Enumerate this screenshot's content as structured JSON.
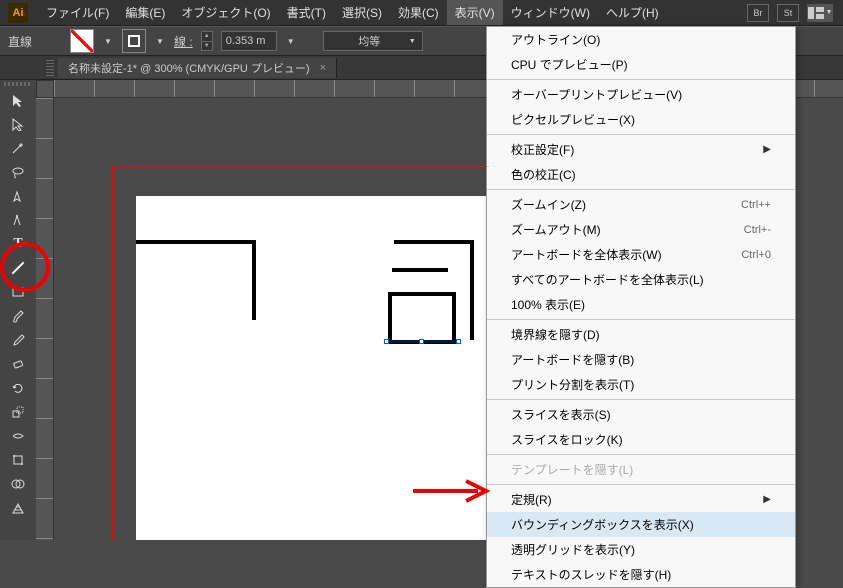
{
  "app": {
    "logo": "Ai"
  },
  "menu": {
    "items": [
      {
        "label": "ファイル(F)"
      },
      {
        "label": "編集(E)"
      },
      {
        "label": "オブジェクト(O)"
      },
      {
        "label": "書式(T)"
      },
      {
        "label": "選択(S)"
      },
      {
        "label": "効果(C)"
      },
      {
        "label": "表示(V)",
        "active": true
      },
      {
        "label": "ウィンドウ(W)"
      },
      {
        "label": "ヘルプ(H)"
      }
    ],
    "right_buttons": [
      "Br",
      "St"
    ]
  },
  "controlbar": {
    "tool_label": "直線",
    "stroke_label": "線 :",
    "stroke_value": "0.353 m",
    "profile_label": "均等"
  },
  "doc_tab": {
    "title": "名称未設定-1* @ 300% (CMYK/GPU プレビュー)",
    "close": "×"
  },
  "dropdown": {
    "groups": [
      [
        {
          "label": "アウトライン(O)"
        },
        {
          "label": "CPU でプレビュー(P)"
        }
      ],
      [
        {
          "label": "オーバープリントプレビュー(V)"
        },
        {
          "label": "ピクセルプレビュー(X)"
        }
      ],
      [
        {
          "label": "校正設定(F)",
          "submenu": true
        },
        {
          "label": "色の校正(C)"
        }
      ],
      [
        {
          "label": "ズームイン(Z)",
          "shortcut": "Ctrl++"
        },
        {
          "label": "ズームアウト(M)",
          "shortcut": "Ctrl+-"
        },
        {
          "label": "アートボードを全体表示(W)",
          "shortcut": "Ctrl+0"
        },
        {
          "label": "すべてのアートボードを全体表示(L)"
        },
        {
          "label": "100% 表示(E)"
        }
      ],
      [
        {
          "label": "境界線を隠す(D)"
        },
        {
          "label": "アートボードを隠す(B)"
        },
        {
          "label": "プリント分割を表示(T)"
        }
      ],
      [
        {
          "label": "スライスを表示(S)"
        },
        {
          "label": "スライスをロック(K)"
        }
      ],
      [
        {
          "label": "テンプレートを隠す(L)",
          "disabled": true
        }
      ],
      [
        {
          "label": "定規(R)",
          "submenu": true
        },
        {
          "label": "バウンディングボックスを表示(X)",
          "highlighted": true
        },
        {
          "label": "透明グリッドを表示(Y)"
        },
        {
          "label": "テキストのスレッドを隠す(H)"
        }
      ]
    ]
  }
}
